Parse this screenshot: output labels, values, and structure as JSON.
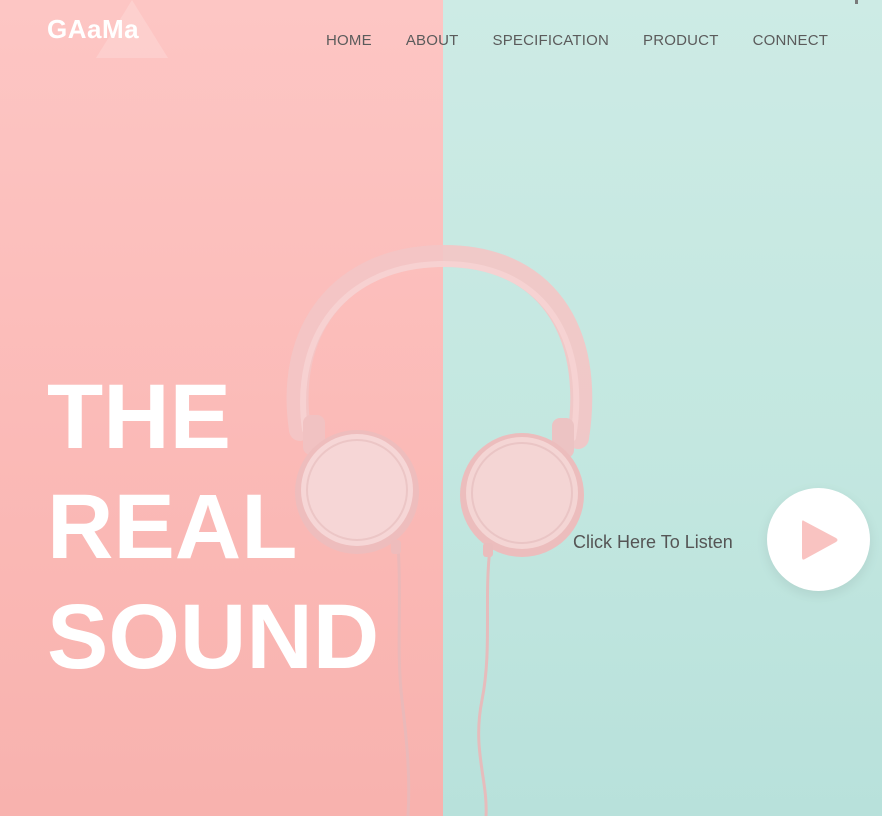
{
  "logo": {
    "text": "GAaMa"
  },
  "nav": {
    "items": [
      {
        "label": "HOME"
      },
      {
        "label": "ABOUT"
      },
      {
        "label": "SPECIFICATION"
      },
      {
        "label": "PRODUCT"
      },
      {
        "label": "CONNECT"
      }
    ]
  },
  "hero": {
    "headline": [
      "THE",
      "REAL",
      "SOUND"
    ],
    "listen_label": "Click Here To Listen",
    "play_icon": "play-icon",
    "image_icon": "headphones-illustration"
  },
  "colors": {
    "left_bg": "#fdc6c4",
    "right_bg": "#cdebe5",
    "headphones": "#f6cfcf",
    "play_triangle": "#f9c3c1",
    "nav_text": "#5b5b5b"
  }
}
